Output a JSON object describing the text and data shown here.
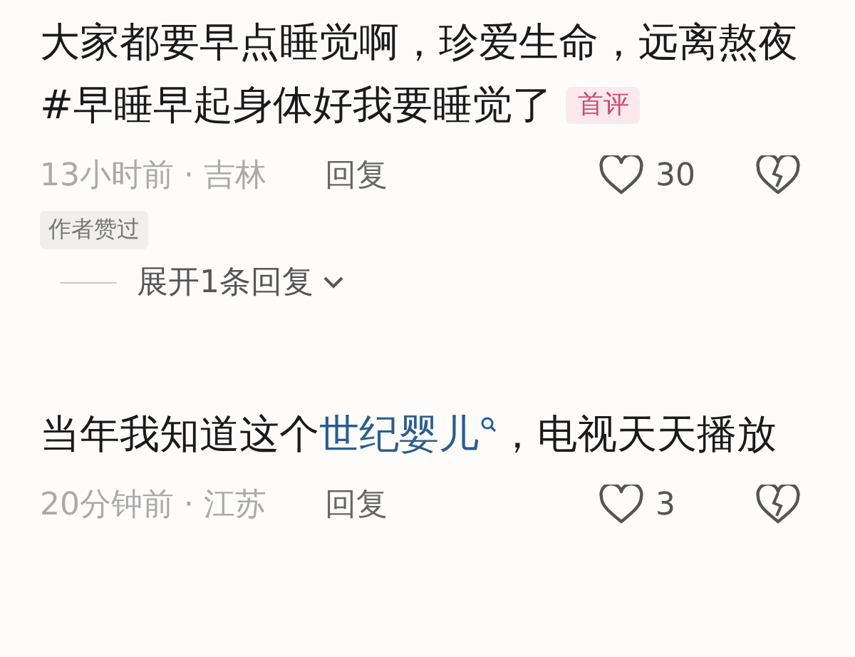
{
  "comments": [
    {
      "segments": [
        {
          "kind": "text",
          "text": "大家都要早点睡觉啊，珍爱生命，远离熬夜 #早睡早起身体好我要睡觉了"
        }
      ],
      "badge": "首评",
      "time_location": "13小时前 · 吉林",
      "reply": "回复",
      "likes": "30",
      "author_liked": "作者赞过",
      "expand": "展开1条回复"
    },
    {
      "segments": [
        {
          "kind": "text",
          "text": "当年我知道这个"
        },
        {
          "kind": "link",
          "text": "世纪婴儿"
        },
        {
          "kind": "text",
          "text": "，电视天天播放"
        }
      ],
      "time_location": "20分钟前 · 江苏",
      "reply": "回复",
      "likes": "3"
    }
  ]
}
